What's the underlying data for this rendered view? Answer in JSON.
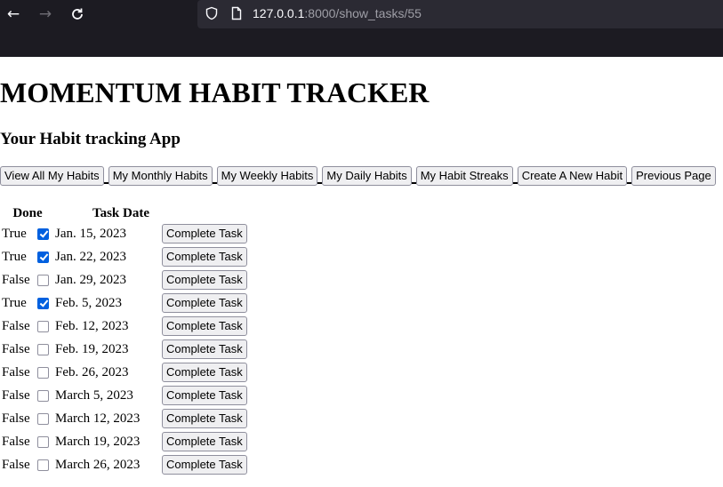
{
  "browser": {
    "url_host": "127.0.0.1",
    "url_path": ":8000/show_tasks/55"
  },
  "page": {
    "title": "MOMENTUM HABIT TRACKER",
    "subtitle": "Your Habit tracking App"
  },
  "nav": [
    "View All My Habits",
    "My Monthly Habits",
    "My Weekly Habits",
    "My Daily Habits",
    "My Habit Streaks",
    "Create A New Habit",
    "Previous Page"
  ],
  "table": {
    "headers": {
      "done": "Done",
      "date": "Task Date"
    },
    "button_label": "Complete Task",
    "rows": [
      {
        "done": "True",
        "checked": true,
        "date": "Jan. 15, 2023"
      },
      {
        "done": "True",
        "checked": true,
        "date": "Jan. 22, 2023"
      },
      {
        "done": "False",
        "checked": false,
        "date": "Jan. 29, 2023"
      },
      {
        "done": "True",
        "checked": true,
        "date": "Feb. 5, 2023"
      },
      {
        "done": "False",
        "checked": false,
        "date": "Feb. 12, 2023"
      },
      {
        "done": "False",
        "checked": false,
        "date": "Feb. 19, 2023"
      },
      {
        "done": "False",
        "checked": false,
        "date": "Feb. 26, 2023"
      },
      {
        "done": "False",
        "checked": false,
        "date": "March 5, 2023"
      },
      {
        "done": "False",
        "checked": false,
        "date": "March 12, 2023"
      },
      {
        "done": "False",
        "checked": false,
        "date": "March 19, 2023"
      },
      {
        "done": "False",
        "checked": false,
        "date": "March 26, 2023"
      }
    ]
  },
  "colors": {
    "chrome": "#1c1b22",
    "urlbar": "#2b2a33",
    "checkbox_checked": "#0060df"
  }
}
